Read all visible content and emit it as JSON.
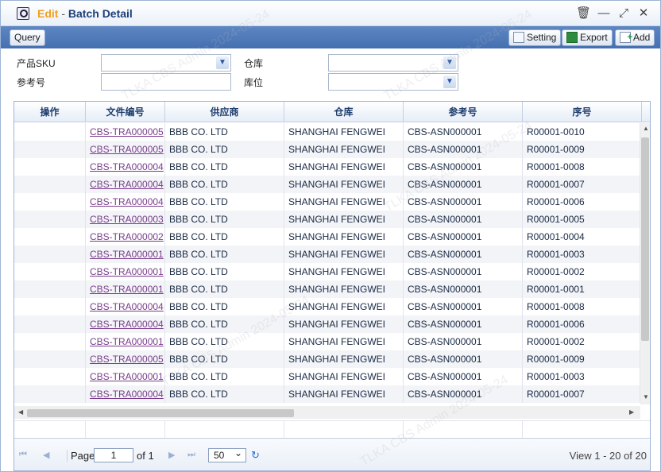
{
  "window": {
    "title_action": "Edit",
    "title_sep": "-",
    "title_name": "Batch Detail",
    "icons": [
      "search-window-icon",
      "delete-icon",
      "minimize-icon",
      "maximize-icon",
      "close-icon"
    ]
  },
  "toolbar": {
    "query_label": "Query",
    "setting_label": "Setting",
    "export_label": "Export",
    "add_label": "Add"
  },
  "filters": {
    "sku_label": "产品SKU",
    "warehouse_label": "仓库",
    "ref_label": "参考号",
    "location_label": "库位",
    "sku_value": "",
    "ref_value": "",
    "warehouse_value": "",
    "location_value": ""
  },
  "grid": {
    "columns": [
      "操作",
      "文件编号",
      "供应商",
      "仓库",
      "参考号",
      "序号"
    ],
    "rows": [
      {
        "op": "",
        "file": "CBS-TRA000005",
        "supplier": "BBB CO. LTD",
        "warehouse": "SHANGHAI FENGWEI",
        "ref": "CBS-ASN000001",
        "seq": "R00001-0010"
      },
      {
        "op": "",
        "file": "CBS-TRA000005",
        "supplier": "BBB CO. LTD",
        "warehouse": "SHANGHAI FENGWEI",
        "ref": "CBS-ASN000001",
        "seq": "R00001-0009"
      },
      {
        "op": "",
        "file": "CBS-TRA000004",
        "supplier": "BBB CO. LTD",
        "warehouse": "SHANGHAI FENGWEI",
        "ref": "CBS-ASN000001",
        "seq": "R00001-0008"
      },
      {
        "op": "",
        "file": "CBS-TRA000004",
        "supplier": "BBB CO. LTD",
        "warehouse": "SHANGHAI FENGWEI",
        "ref": "CBS-ASN000001",
        "seq": "R00001-0007"
      },
      {
        "op": "",
        "file": "CBS-TRA000004",
        "supplier": "BBB CO. LTD",
        "warehouse": "SHANGHAI FENGWEI",
        "ref": "CBS-ASN000001",
        "seq": "R00001-0006"
      },
      {
        "op": "",
        "file": "CBS-TRA000003",
        "supplier": "BBB CO. LTD",
        "warehouse": "SHANGHAI FENGWEI",
        "ref": "CBS-ASN000001",
        "seq": "R00001-0005"
      },
      {
        "op": "",
        "file": "CBS-TRA000002",
        "supplier": "BBB CO. LTD",
        "warehouse": "SHANGHAI FENGWEI",
        "ref": "CBS-ASN000001",
        "seq": "R00001-0004"
      },
      {
        "op": "",
        "file": "CBS-TRA000001",
        "supplier": "BBB CO. LTD",
        "warehouse": "SHANGHAI FENGWEI",
        "ref": "CBS-ASN000001",
        "seq": "R00001-0003"
      },
      {
        "op": "",
        "file": "CBS-TRA000001",
        "supplier": "BBB CO. LTD",
        "warehouse": "SHANGHAI FENGWEI",
        "ref": "CBS-ASN000001",
        "seq": "R00001-0002"
      },
      {
        "op": "",
        "file": "CBS-TRA000001",
        "supplier": "BBB CO. LTD",
        "warehouse": "SHANGHAI FENGWEI",
        "ref": "CBS-ASN000001",
        "seq": "R00001-0001"
      },
      {
        "op": "",
        "file": "CBS-TRA000004",
        "supplier": "BBB CO. LTD",
        "warehouse": "SHANGHAI FENGWEI",
        "ref": "CBS-ASN000001",
        "seq": "R00001-0008"
      },
      {
        "op": "",
        "file": "CBS-TRA000004",
        "supplier": "BBB CO. LTD",
        "warehouse": "SHANGHAI FENGWEI",
        "ref": "CBS-ASN000001",
        "seq": "R00001-0006"
      },
      {
        "op": "",
        "file": "CBS-TRA000001",
        "supplier": "BBB CO. LTD",
        "warehouse": "SHANGHAI FENGWEI",
        "ref": "CBS-ASN000001",
        "seq": "R00001-0002"
      },
      {
        "op": "",
        "file": "CBS-TRA000005",
        "supplier": "BBB CO. LTD",
        "warehouse": "SHANGHAI FENGWEI",
        "ref": "CBS-ASN000001",
        "seq": "R00001-0009"
      },
      {
        "op": "",
        "file": "CBS-TRA000001",
        "supplier": "BBB CO. LTD",
        "warehouse": "SHANGHAI FENGWEI",
        "ref": "CBS-ASN000001",
        "seq": "R00001-0003"
      },
      {
        "op": "",
        "file": "CBS-TRA000004",
        "supplier": "BBB CO. LTD",
        "warehouse": "SHANGHAI FENGWEI",
        "ref": "CBS-ASN000001",
        "seq": "R00001-0007"
      }
    ]
  },
  "pager": {
    "page_label": "Page",
    "page_value": "1",
    "of_label": "of 1",
    "page_size": "50",
    "view_text": "View 1 - 20 of 20"
  },
  "watermark": "TLKA CBS Admin 2024-05-24"
}
